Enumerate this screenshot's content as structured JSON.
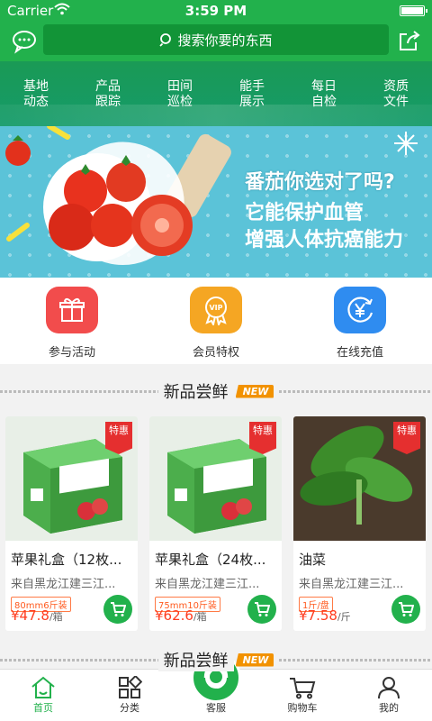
{
  "status": {
    "carrier": "Carrier",
    "time": "3:59 PM"
  },
  "search": {
    "placeholder": "搜索你要的东西"
  },
  "nav": [
    {
      "line1": "基地",
      "line2": "动态"
    },
    {
      "line1": "产品",
      "line2": "跟踪"
    },
    {
      "line1": "田间",
      "line2": "巡检"
    },
    {
      "line1": "能手",
      "line2": "展示"
    },
    {
      "line1": "每日",
      "line2": "自检"
    },
    {
      "line1": "资质",
      "line2": "文件"
    }
  ],
  "banner": {
    "line1": "番茄你选对了吗?",
    "line2": "它能保护血管",
    "line3": "增强人体抗癌能力"
  },
  "quick": [
    {
      "label": "参与活动",
      "icon": "gift-icon",
      "color": "#f24c4c"
    },
    {
      "label": "会员特权",
      "icon": "vip-badge-icon",
      "color": "#f5a623"
    },
    {
      "label": "在线充值",
      "icon": "yen-coin-icon",
      "color": "#2f8cf0"
    }
  ],
  "section": {
    "title": "新品尝鲜",
    "tag": "NEW"
  },
  "products": [
    {
      "name": "苹果礼盒（12枚...",
      "origin": "来自黑龙江建三江...",
      "spec": "80mm6斤装",
      "price": "¥47.8",
      "unit": "/箱",
      "tag": "特惠"
    },
    {
      "name": "苹果礼盒（24枚...",
      "origin": "来自黑龙江建三江...",
      "spec": "75mm10斤装",
      "price": "¥62.6",
      "unit": "/箱",
      "tag": "特惠"
    },
    {
      "name": "油菜",
      "origin": "来自黑龙江建三江...",
      "spec": "1斤/盘",
      "price": "¥7.58",
      "unit": "/斤",
      "tag": "特惠"
    }
  ],
  "tabs": [
    {
      "label": "首页",
      "icon": "home-icon"
    },
    {
      "label": "分类",
      "icon": "category-grid-icon"
    },
    {
      "label": "客服",
      "icon": "customer-service-icon"
    },
    {
      "label": "购物车",
      "icon": "cart-icon"
    },
    {
      "label": "我的",
      "icon": "user-icon"
    }
  ],
  "colors": {
    "primary": "#22b14c",
    "price": "#ff3b1f",
    "new_tag": "#f29200"
  }
}
